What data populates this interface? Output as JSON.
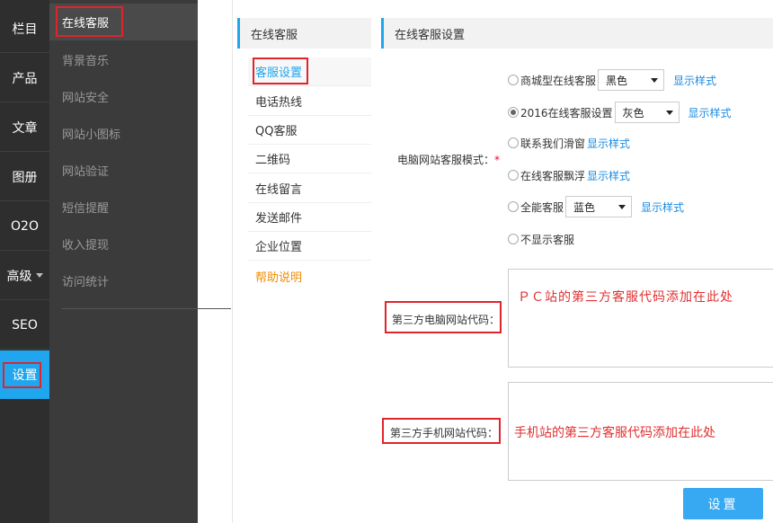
{
  "main_nav": [
    {
      "label": "栏目"
    },
    {
      "label": "产品"
    },
    {
      "label": "文章"
    },
    {
      "label": "图册"
    },
    {
      "label": "O2O"
    },
    {
      "label": "高级"
    },
    {
      "label": "SEO"
    },
    {
      "label": "设置"
    }
  ],
  "sub_nav": [
    {
      "label": "在线客服"
    },
    {
      "label": "背景音乐"
    },
    {
      "label": "网站安全"
    },
    {
      "label": "网站小图标"
    },
    {
      "label": "网站验证"
    },
    {
      "label": "短信提醒"
    },
    {
      "label": "收入提现"
    },
    {
      "label": "访问统计"
    }
  ],
  "middle": {
    "title": "在线客服",
    "items": [
      {
        "label": "客服设置"
      },
      {
        "label": "电话热线"
      },
      {
        "label": "QQ客服"
      },
      {
        "label": "二维码"
      },
      {
        "label": "在线留言"
      },
      {
        "label": "发送邮件"
      },
      {
        "label": "企业位置"
      },
      {
        "label": "帮助说明"
      }
    ]
  },
  "content": {
    "title": "在线客服设置",
    "pc_mode_label": "电脑网站客服模式：",
    "required_mark": "*",
    "options": [
      {
        "label": "商城型在线客服",
        "select": "黑色",
        "link": "显示样式",
        "checked": false
      },
      {
        "label": "2016在线客服设置",
        "select": "灰色",
        "link": "显示样式",
        "checked": true
      },
      {
        "label": "联系我们滑窗",
        "link": "显示样式",
        "checked": false
      },
      {
        "label": "在线客服飘浮",
        "link": "显示样式",
        "checked": false
      },
      {
        "label": "全能客服",
        "select": "蓝色",
        "link": "显示样式",
        "checked": false
      },
      {
        "label": "不显示客服",
        "checked": false
      }
    ],
    "pc_code_label": "第三方电脑网站代码：",
    "pc_code_value": "ＰＣ站的第三方客服代码添加在此处",
    "mobile_code_label": "第三方手机网站代码：",
    "mobile_code_value": "手机站的第三方客服代码添加在此处",
    "submit_label": "设置"
  },
  "colors": {
    "accent": "#1fa6ee",
    "annotation": "#e0242b",
    "help": "#f08c00"
  }
}
